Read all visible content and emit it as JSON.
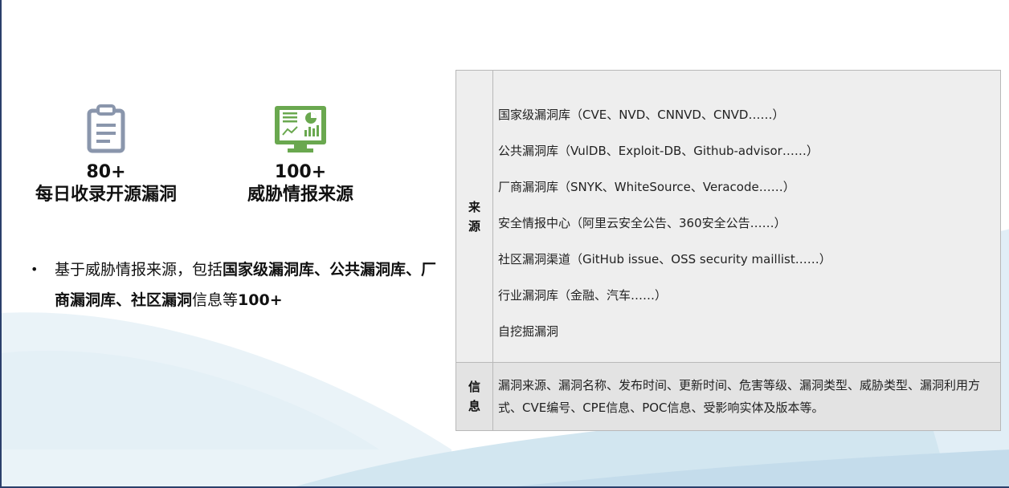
{
  "stats": [
    {
      "icon": "clipboard-icon",
      "number": "80+",
      "label": "每日收录开源漏洞"
    },
    {
      "icon": "dashboard-monitor-icon",
      "number": "100+",
      "label": "威胁情报来源"
    }
  ],
  "bullet": {
    "marker": "•",
    "parts": [
      "基于威胁情报来源，包括",
      "国家级漏洞库、公共漏洞库、厂商漏洞库、社区漏洞",
      "信息等",
      "100+"
    ]
  },
  "table": {
    "source_header": "来\n源",
    "sources": [
      "国家级漏洞库（CVE、NVD、CNNVD、CNVD……）",
      "公共漏洞库（VulDB、Exploit-DB、Github-advisor……）",
      "厂商漏洞库（SNYK、WhiteSource、Veracode……）",
      "安全情报中心（阿里云安全公告、360安全公告……）",
      "社区漏洞渠道（GitHub issue、OSS security maillist……）",
      "行业漏洞库（金融、汽车……）",
      "自挖掘漏洞"
    ],
    "info_header": "信\n息",
    "info_text": "漏洞来源、漏洞名称、发布时间、更新时间、危害等级、漏洞类型、威胁类型、漏洞利用方式、CVE编号、CPE信息、POC信息、受影响实体及版本等。"
  },
  "colors": {
    "icon_gray": "#8a96ac",
    "icon_green": "#6aa84f",
    "frame": "#2b3f6b",
    "wave": "#cfe3ee"
  }
}
